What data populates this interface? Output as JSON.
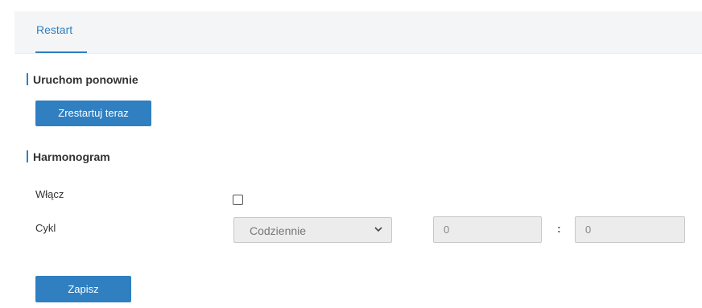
{
  "tabs": [
    {
      "label": "Restart",
      "active": true
    }
  ],
  "sections": {
    "restart": {
      "title": "Uruchom ponownie",
      "button_label": "Zrestartuj teraz"
    },
    "schedule": {
      "title": "Harmonogram",
      "enable_label": "Włącz",
      "enable_checked": false,
      "cycle_label": "Cykl",
      "cycle_value": "Codziennie",
      "hour_value": "0",
      "separator": ":",
      "minute_value": "0"
    }
  },
  "save_label": "Zapisz",
  "colors": {
    "accent": "#2f7fc1",
    "tabbar_bg": "#f4f5f7",
    "input_bg": "#ececec"
  },
  "icons": {
    "dropdown": "chevron-down-icon"
  }
}
